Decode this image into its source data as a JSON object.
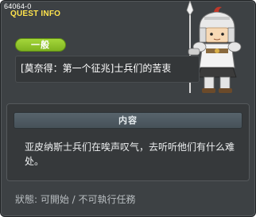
{
  "window": {
    "quest_id": "64064-0",
    "title": "QUEST INFO"
  },
  "quest": {
    "category": "一般",
    "name": "[莫奈得：第一个征兆]士兵们的苦衷"
  },
  "content": {
    "header": "内容",
    "text": "亚皮纳斯士兵们在唉声叹气，去听听他们有什么难处。"
  },
  "status": {
    "text": "狀態: 可開始 / 不可執行任務"
  },
  "colors": {
    "title": "#ffe34d",
    "badge": "#8fc42b",
    "background": "#3d4144"
  },
  "icons": {
    "character": "armored-knight-with-spear"
  }
}
